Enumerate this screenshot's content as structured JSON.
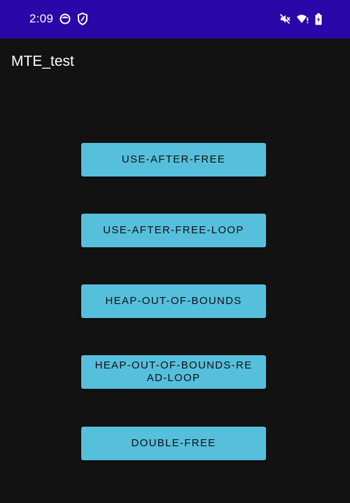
{
  "status_bar": {
    "time": "2:09",
    "left_icons": [
      "face-icon",
      "shield-icon"
    ],
    "right_icons": [
      "mute-icon",
      "wifi-icon",
      "battery-icon"
    ],
    "background": "#2a07a8"
  },
  "app_bar": {
    "title": "MTE_test"
  },
  "buttons": [
    {
      "label": "USE-AFTER-FREE"
    },
    {
      "label": "USE-AFTER-FREE-LOOP"
    },
    {
      "label": "HEAP-OUT-OF-BOUNDS"
    },
    {
      "label": "HEAP-OUT-OF-BOUNDS-READ-LOOP"
    },
    {
      "label": "DOUBLE-FREE"
    }
  ],
  "colors": {
    "button": "#56bfdc",
    "background": "#121212",
    "button_text": "#101010"
  }
}
